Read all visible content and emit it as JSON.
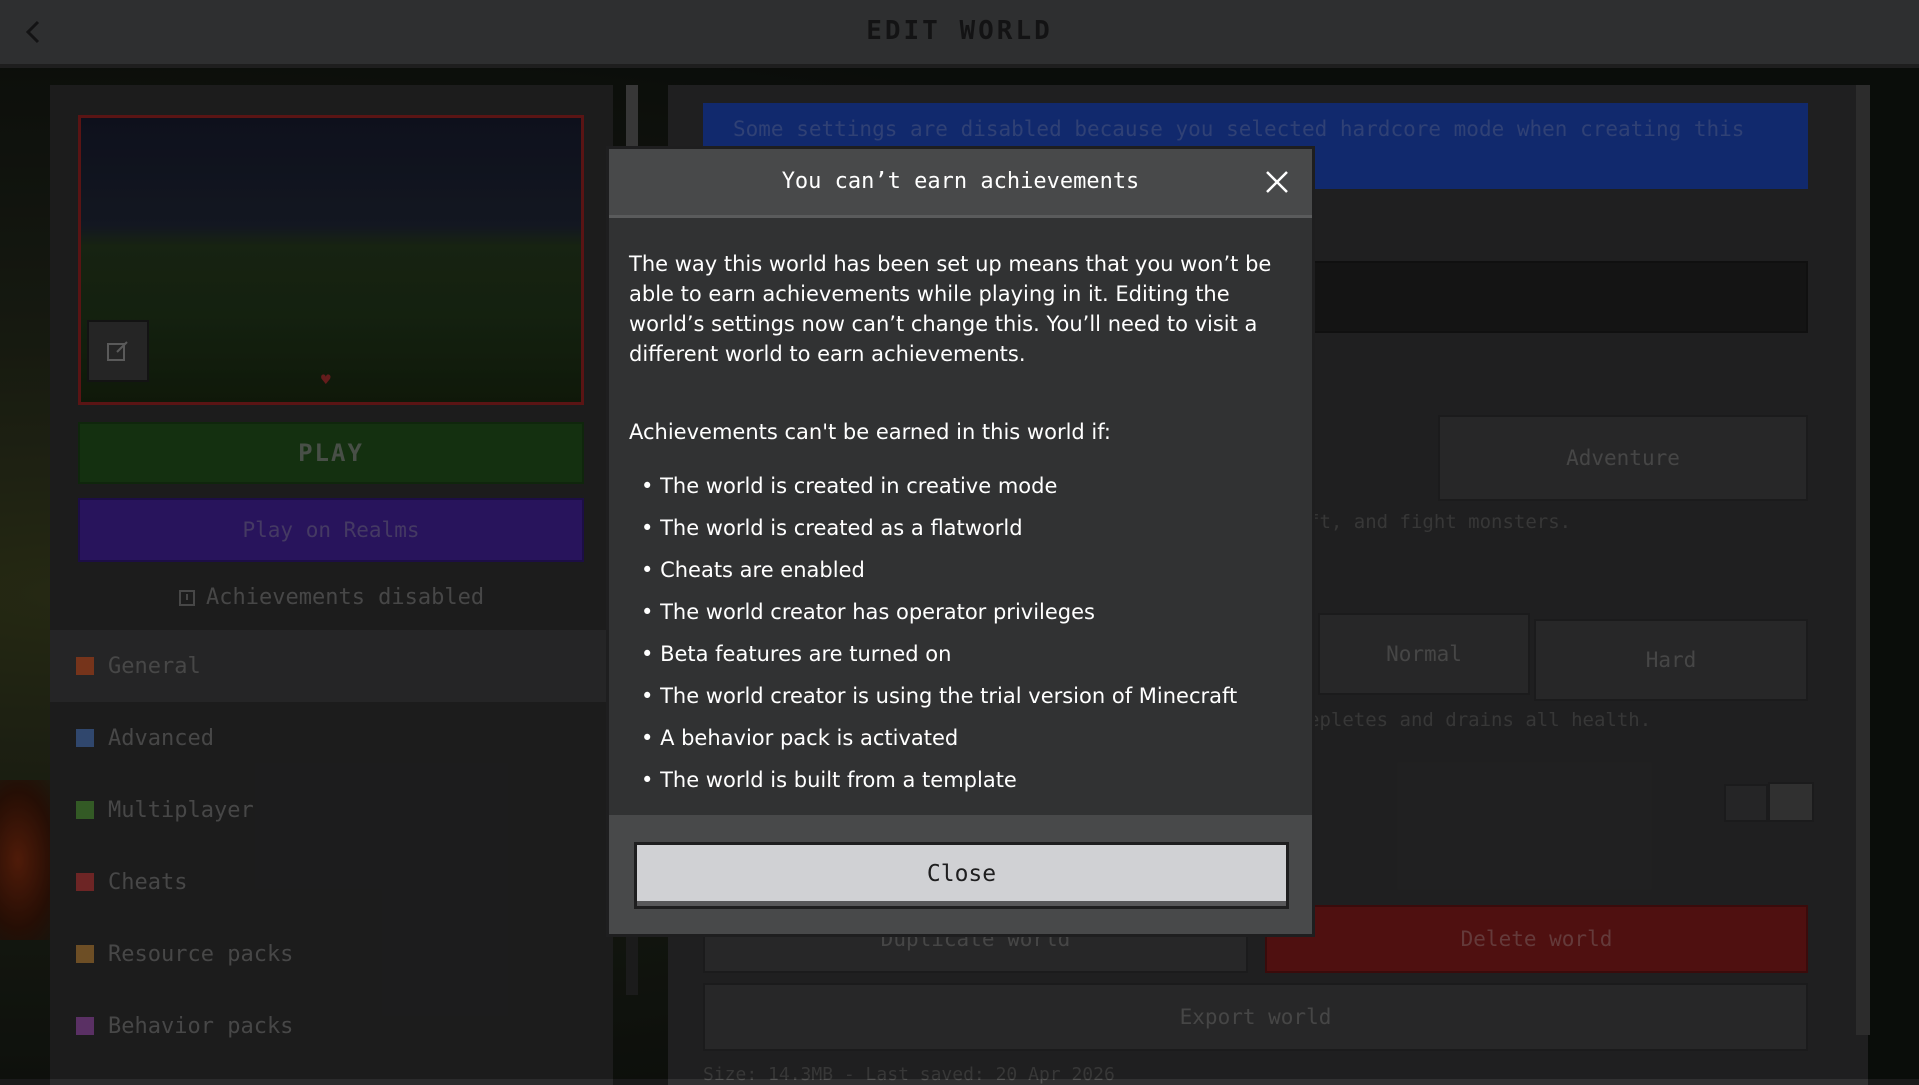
{
  "header": {
    "title": "EDIT WORLD"
  },
  "left": {
    "play_label": "PLAY",
    "realms_label": "Play on Realms",
    "achievements_label": "Achievements disabled",
    "nav": [
      {
        "label": "General",
        "icon": "globe-icon",
        "color": "#b5502a"
      },
      {
        "label": "Advanced",
        "icon": "advanced-icon",
        "color": "#4a6ea8"
      },
      {
        "label": "Multiplayer",
        "icon": "multiplayer-icon",
        "color": "#4f8a3a"
      },
      {
        "label": "Cheats",
        "icon": "cheats-icon",
        "color": "#a83a3a"
      },
      {
        "label": "Resource packs",
        "icon": "resource-packs-icon",
        "color": "#a8783a"
      },
      {
        "label": "Behavior packs",
        "icon": "behavior-packs-icon",
        "color": "#8a4a9a"
      }
    ]
  },
  "right": {
    "banner_text": "Some settings are disabled because you selected hardcore mode when creating this",
    "adventure_label": "Adventure",
    "game_mode_desc": "ft, and fight monsters.",
    "normal_label": "Normal",
    "hard_label": "Hard",
    "difficulty_desc": "epletes and drains all health.",
    "duplicate_label": "Duplicate world",
    "delete_label": "Delete world",
    "export_label": "Export world",
    "footer": "Size: 14.3MB - Last saved: 20 Apr 2026"
  },
  "modal": {
    "title": "You can’t earn achievements",
    "body": "The way this world has been set up means that you won’t be able to earn achievements while playing in it. Editing the world’s settings now can’t change this. You’ll need to visit a different world to earn achievements.",
    "subhead": "Achievements can't be earned in this world if:",
    "bullets": [
      "The world is created in creative mode",
      "The world is created as a flatworld",
      "Cheats are enabled",
      "The world creator has operator privileges",
      "Beta features are turned on",
      "The world creator is using the trial version of Minecraft",
      "A behavior pack is activated",
      "The world is built from a template"
    ],
    "close_label": "Close"
  }
}
